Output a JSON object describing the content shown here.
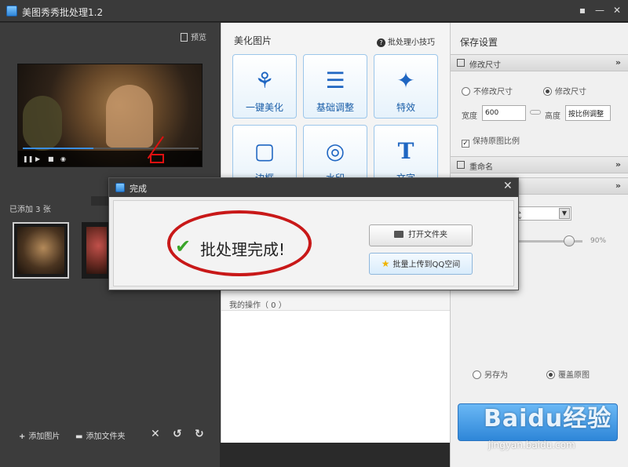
{
  "window": {
    "title": "美图秀秀批处理1.2",
    "buttons": {
      "menu": "▪",
      "minimize": "—",
      "close": "✕"
    }
  },
  "left": {
    "preview_label": "预览",
    "added_count": "已添加 3 张",
    "toolbar": {
      "add_image": "添加图片",
      "add_folder": "添加文件夹",
      "delete": "✕",
      "rotate_left": "↺",
      "rotate_right": "↻"
    }
  },
  "middle": {
    "title": "美化图片",
    "tips": "批处理小技巧",
    "tools": [
      {
        "label": "一键美化",
        "icon": "tulip-icon"
      },
      {
        "label": "基础调整",
        "icon": "sliders-icon"
      },
      {
        "label": "特效",
        "icon": "magic-wand-icon"
      },
      {
        "label": "边框",
        "icon": "frame-icon"
      },
      {
        "label": "水印",
        "icon": "watermark-icon"
      },
      {
        "label": "文字",
        "icon": "text-icon"
      }
    ],
    "ops_label": "我的操作（ 0 ）"
  },
  "right": {
    "title": "保存设置",
    "resize_section": "修改尺寸",
    "no_resize": "不修改尺寸",
    "resize": "修改尺寸",
    "width_label": "宽度",
    "width_value": "600",
    "height_label": "高度",
    "height_value": "按比例调整",
    "keep_ratio": "保持原图比例",
    "rename_section": "重命名",
    "format_value": "式",
    "quality_value": "90%",
    "save_as": "另存为",
    "overwrite": "覆盖原图"
  },
  "dialog": {
    "title": "完成",
    "close": "✕",
    "message": "批处理完成!",
    "open_folder": "打开文件夹",
    "upload_qq": "批量上传到QQ空间"
  },
  "watermark": {
    "brand": "Baidu经验",
    "url": "jingyan.baidu.com"
  }
}
